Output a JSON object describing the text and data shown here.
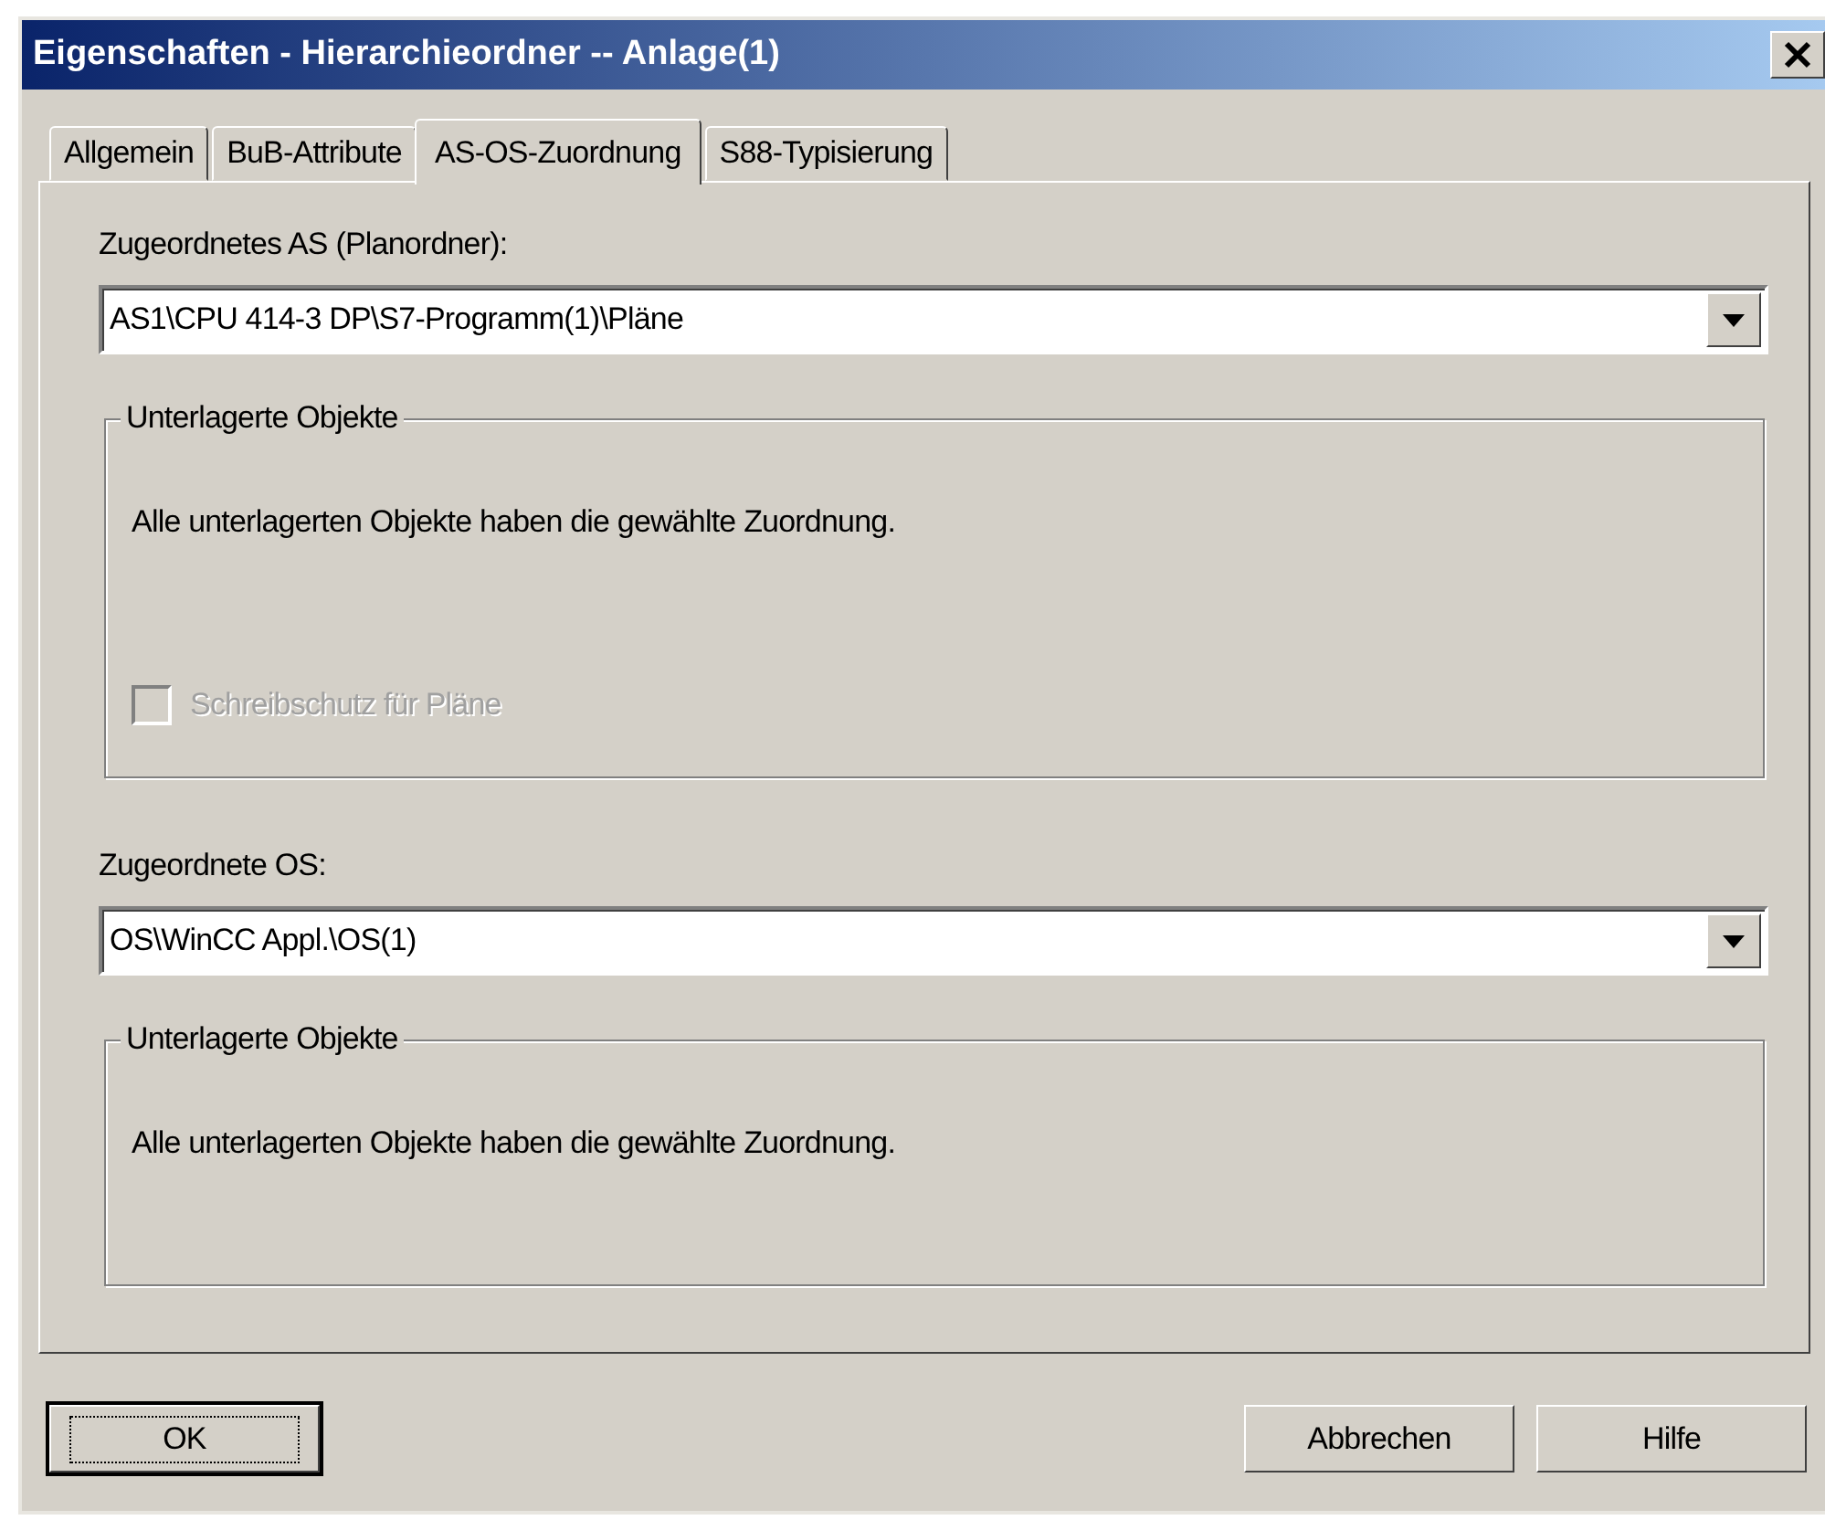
{
  "window": {
    "title": "Eigenschaften - Hierarchieordner -- Anlage(1)"
  },
  "tabs": [
    {
      "label": "Allgemein",
      "selected": false
    },
    {
      "label": "BuB-Attribute",
      "selected": false
    },
    {
      "label": "AS-OS-Zuordnung",
      "selected": true
    },
    {
      "label": "S88-Typisierung",
      "selected": false
    }
  ],
  "sections": [
    {
      "label": "Zugeordnetes AS (Planordner):",
      "dropdown": {
        "value": "AS1\\CPU 414-3 DP\\S7-Programm(1)\\Pläne"
      },
      "group": {
        "title": "Unterlagerte Objekte",
        "message": "Alle unterlagerten Objekte haben die gewählte Zuordnung.",
        "checkbox": {
          "label": "Schreibschutz für Pläne",
          "checked": false,
          "disabled": true
        }
      }
    },
    {
      "label": "Zugeordnete OS:",
      "dropdown": {
        "value": "OS\\WinCC Appl.\\OS(1)"
      },
      "group": {
        "title": "Unterlagerte Objekte",
        "message": "Alle unterlagerten Objekte haben die gewählte Zuordnung."
      }
    }
  ],
  "buttons": [
    {
      "label": "OK",
      "default": true
    },
    {
      "label": "Abbrechen",
      "default": false
    },
    {
      "label": "Hilfe",
      "default": false
    }
  ]
}
